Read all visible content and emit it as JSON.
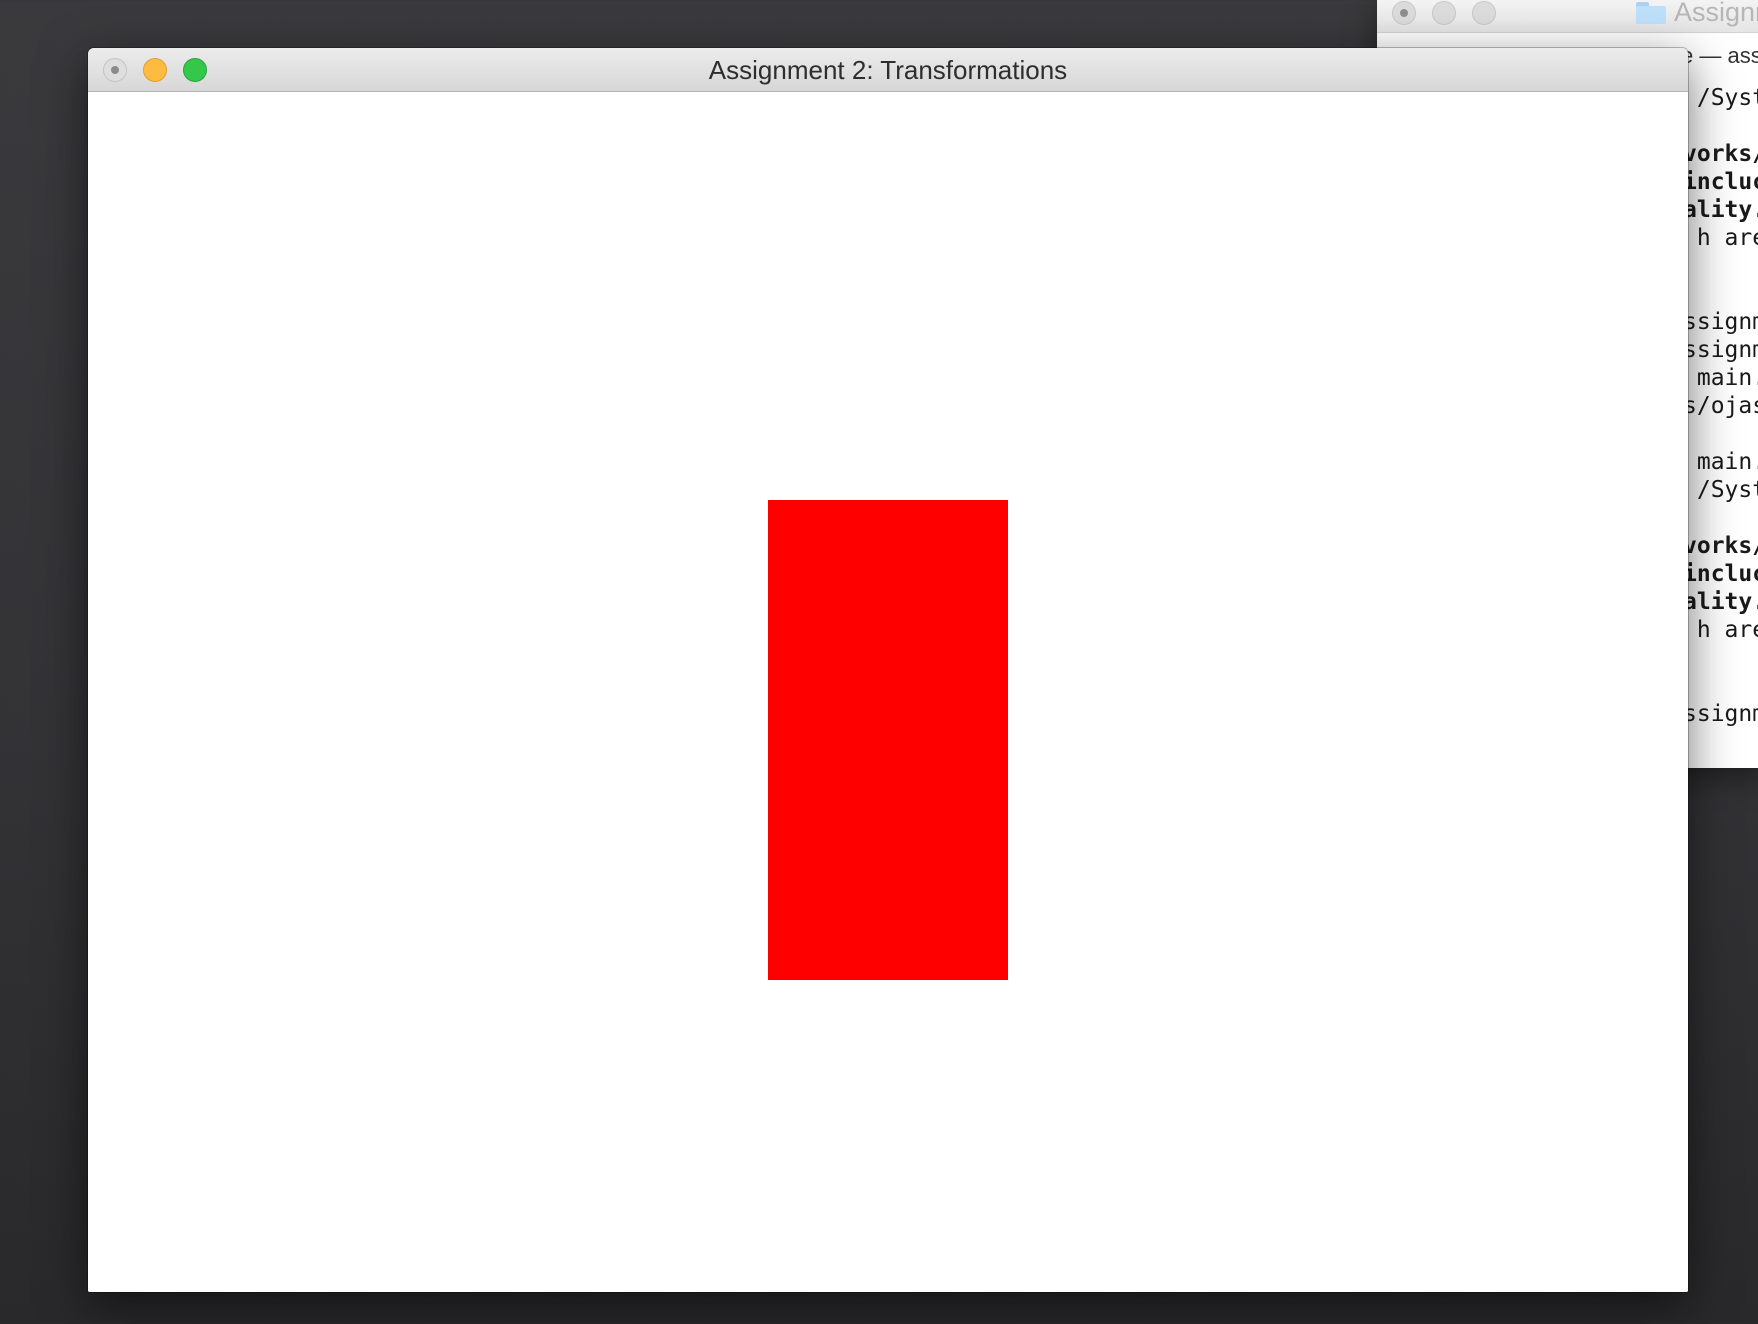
{
  "background_window": {
    "title": "Assignm",
    "subtitle": "e — ass",
    "terminal_lines": [
      {
        "text": " /Syst",
        "bold": false
      },
      {
        "text": "vorks/",
        "bold": true
      },
      {
        "text": "incluc",
        "bold": true
      },
      {
        "text": "ality.",
        "bold": true
      },
      {
        "text": " h are",
        "bold": false
      },
      {
        "text": "ssignm",
        "bold": false
      },
      {
        "text": "ssignm",
        "bold": false
      },
      {
        "text": " main.",
        "bold": false
      },
      {
        "text": "s/ojas",
        "bold": false
      },
      {
        "text": " main.",
        "bold": false
      },
      {
        "text": " /Syst",
        "bold": false
      },
      {
        "text": "vorks/",
        "bold": true
      },
      {
        "text": "incluc",
        "bold": true
      },
      {
        "text": "ality.",
        "bold": true
      },
      {
        "text": " h are",
        "bold": false
      },
      {
        "text": "ssignm",
        "bold": false
      }
    ]
  },
  "main_window": {
    "title": "Assignment 2: Transformations",
    "canvas_background": "#ffffff",
    "shape": {
      "type": "rectangle",
      "color": "#ff0000"
    }
  },
  "colors": {
    "desktop": "#353538",
    "close_button": "#dedede",
    "minimize_button": "#fdbc40",
    "zoom_button": "#34c84a"
  }
}
